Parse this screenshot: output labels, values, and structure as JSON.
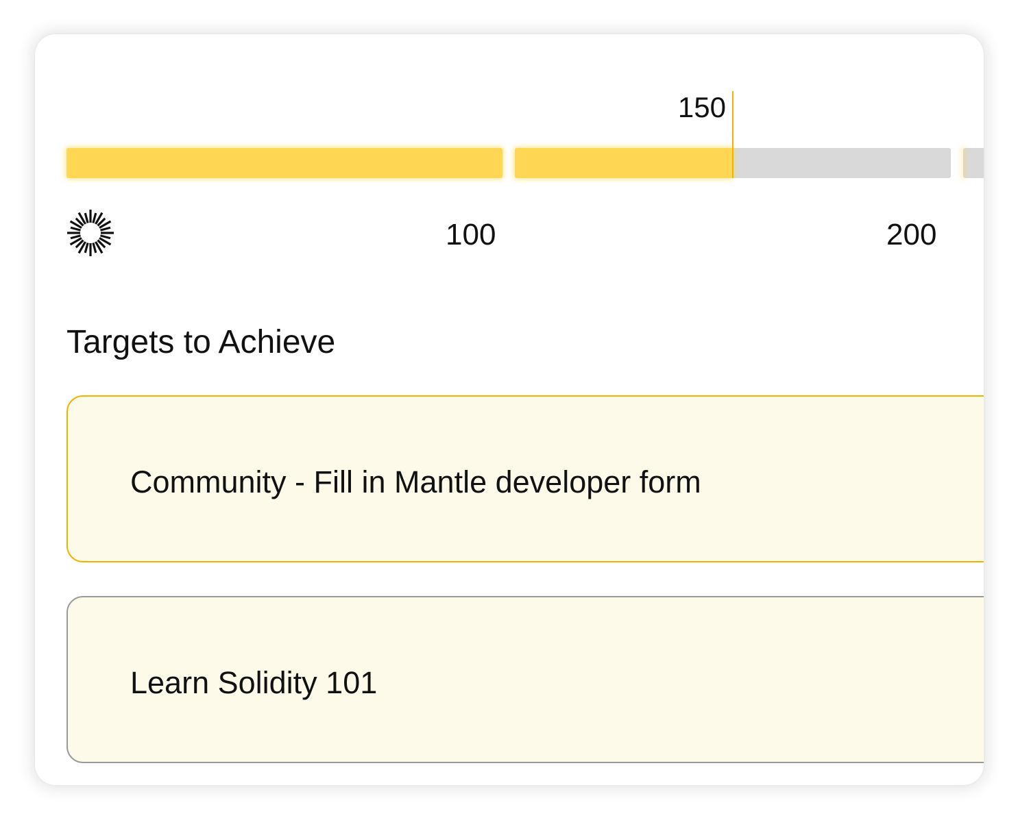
{
  "progress": {
    "current_value": 150,
    "marker_label": "150",
    "segments": [
      {
        "from": 0,
        "to": 100,
        "filled_fraction": 1.0
      },
      {
        "from": 100,
        "to": 200,
        "filled_fraction": 0.5
      },
      {
        "from": 200,
        "to": 300,
        "filled_fraction": 0.0
      }
    ],
    "tick_labels": [
      "100",
      "200"
    ],
    "colors": {
      "filled": "#ffd755",
      "track": "#d9d9d9",
      "marker": "#f0b400"
    }
  },
  "brand": {
    "icon": "starburst-logo-icon"
  },
  "targets": {
    "title": "Targets to Achieve",
    "items": [
      {
        "label": "Community - Fill in Mantle developer form",
        "state": "active"
      },
      {
        "label": "Learn Solidity 101",
        "state": "inactive"
      }
    ],
    "colors": {
      "card_background": "#fefaea",
      "active_border": "#f0b400",
      "inactive_border": "#9a9a9a"
    }
  }
}
